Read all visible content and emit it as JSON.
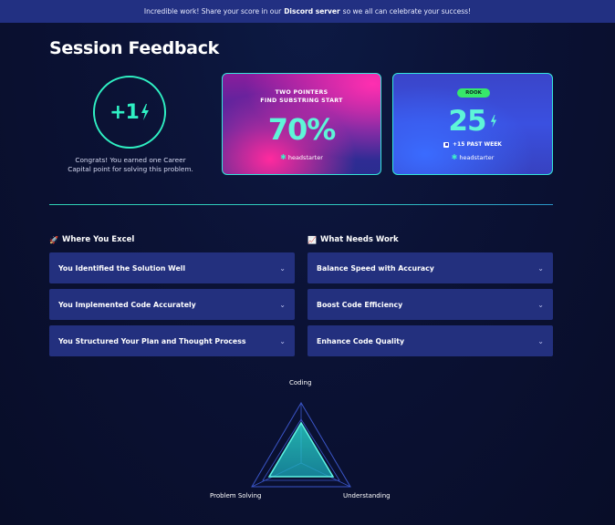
{
  "banner": {
    "prefix": "Incredible work! Share your score in our",
    "link": "Discord server",
    "suffix": "so we all can celebrate your success!"
  },
  "page": {
    "title": "Session Feedback"
  },
  "career_capital": {
    "value": "+1",
    "icon": "lightning-icon",
    "message": "Congrats! You earned one Career Capital point for solving this problem."
  },
  "problem_card": {
    "category": "TWO POINTERS",
    "problem": "FIND SUBSTRING START",
    "score": "70%",
    "brand": "headstarter"
  },
  "level_card": {
    "badge": "ROOK",
    "points": "25",
    "icon": "lightning-icon",
    "past_week": "+15 PAST WEEK",
    "brand": "headstarter"
  },
  "excel": {
    "heading": "Where You Excel",
    "icon": "rocket-icon",
    "items": [
      {
        "label": "You Identified the Solution Well"
      },
      {
        "label": "You Implemented Code Accurately"
      },
      {
        "label": "You Structured Your Plan and Thought Process"
      }
    ]
  },
  "needs_work": {
    "heading": "What Needs Work",
    "icon": "chart-icon",
    "items": [
      {
        "label": "Balance Speed with Accuracy"
      },
      {
        "label": "Boost Code Efficiency"
      },
      {
        "label": "Enhance Code Quality"
      }
    ]
  },
  "radar": {
    "labels": {
      "top": "Coding",
      "left": "Problem Solving",
      "right": "Understanding"
    }
  },
  "colors": {
    "accent": "#2ff0c3",
    "banner": "#223082",
    "accordion": "#23307e",
    "badge": "#37e86a"
  }
}
